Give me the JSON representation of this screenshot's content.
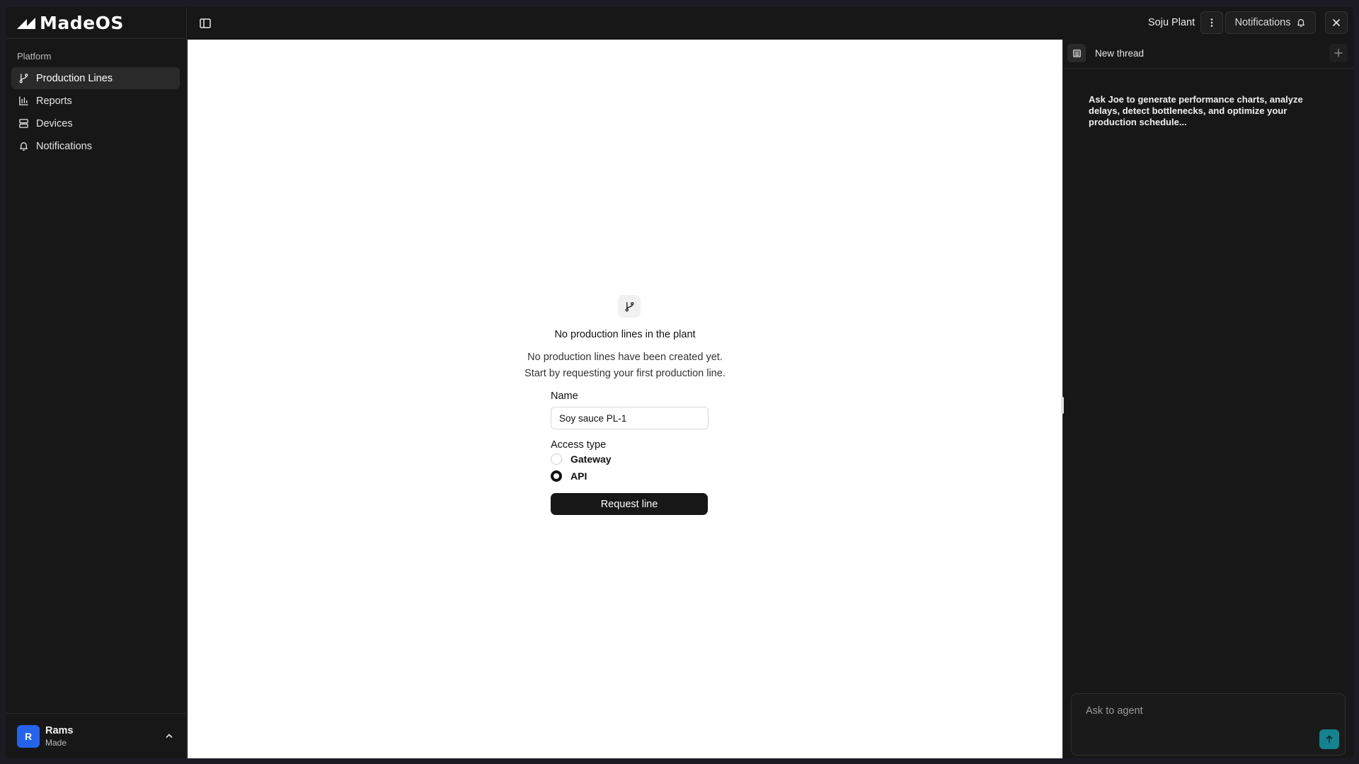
{
  "app": {
    "brand": "MadeOS"
  },
  "sidebar": {
    "section_label": "Platform",
    "items": [
      {
        "label": "Production Lines",
        "icon": "git-branch-icon",
        "active": true
      },
      {
        "label": "Reports",
        "icon": "bar-chart-icon",
        "active": false
      },
      {
        "label": "Devices",
        "icon": "server-icon",
        "active": false
      },
      {
        "label": "Notifications",
        "icon": "bell-icon",
        "active": false
      }
    ],
    "user": {
      "initial": "R",
      "name": "Rams",
      "org": "Made"
    }
  },
  "topbar": {
    "plant": "Soju Plant",
    "notifications_label": "Notifications"
  },
  "main": {
    "empty_title": "No production lines in the plant",
    "empty_desc_1": "No production lines have been created yet.",
    "empty_desc_2": "Start by requesting your first production line.",
    "form": {
      "name_label": "Name",
      "name_value": "Soy sauce PL-1",
      "access_label": "Access type",
      "options": [
        {
          "label": "Gateway",
          "checked": false
        },
        {
          "label": "API",
          "checked": true
        }
      ],
      "submit_label": "Request line"
    }
  },
  "panel": {
    "title": "New thread",
    "hint": "Ask Joe to generate performance charts, analyze delays, detect bottlenecks, and optimize your production schedule...",
    "input_placeholder": "Ask to agent"
  },
  "colors": {
    "accent": "#14838f",
    "avatar": "#2563eb",
    "dark": "#171717"
  }
}
